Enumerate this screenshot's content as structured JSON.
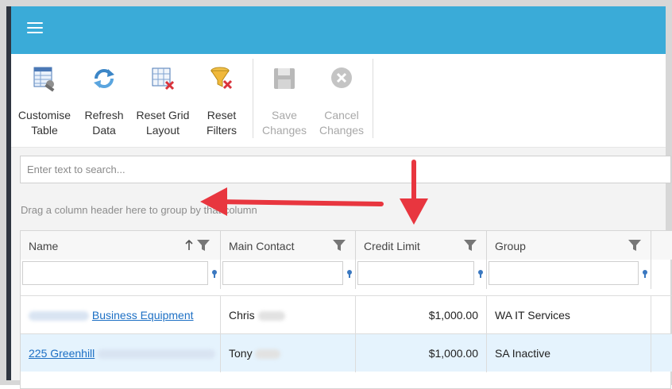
{
  "ribbon": {
    "buttons": [
      {
        "label_line1": "Customise",
        "label_line2": "Table",
        "icon": "customise-table-icon",
        "enabled": true
      },
      {
        "label_line1": "Refresh",
        "label_line2": "Data",
        "icon": "refresh-icon",
        "enabled": true
      },
      {
        "label_line1": "Reset Grid",
        "label_line2": "Layout",
        "icon": "reset-grid-icon",
        "enabled": true
      },
      {
        "label_line1": "Reset",
        "label_line2": "Filters",
        "icon": "reset-filters-icon",
        "enabled": true
      },
      {
        "label_line1": "Save",
        "label_line2": "Changes",
        "icon": "save-icon",
        "enabled": false
      },
      {
        "label_line1": "Cancel",
        "label_line2": "Changes",
        "icon": "cancel-icon",
        "enabled": false
      }
    ]
  },
  "search": {
    "placeholder": "Enter text to search..."
  },
  "group_hint": "Drag a column header here to group by that column",
  "grid": {
    "columns": [
      "Name",
      "Main Contact",
      "Credit Limit",
      "Group"
    ],
    "rows": [
      {
        "name": "Business Equipment",
        "contact": "Chris",
        "credit": "$1,000.00",
        "group": "WA IT Services"
      },
      {
        "name": "225 Greenhill",
        "contact": "Tony",
        "credit": "$1,000.00",
        "group": "SA Inactive"
      }
    ]
  },
  "colors": {
    "topbar": "#3aabd8",
    "link": "#1c6fc4",
    "selected_row": "#e5f3fd",
    "annotation_arrow": "#e8363f"
  }
}
